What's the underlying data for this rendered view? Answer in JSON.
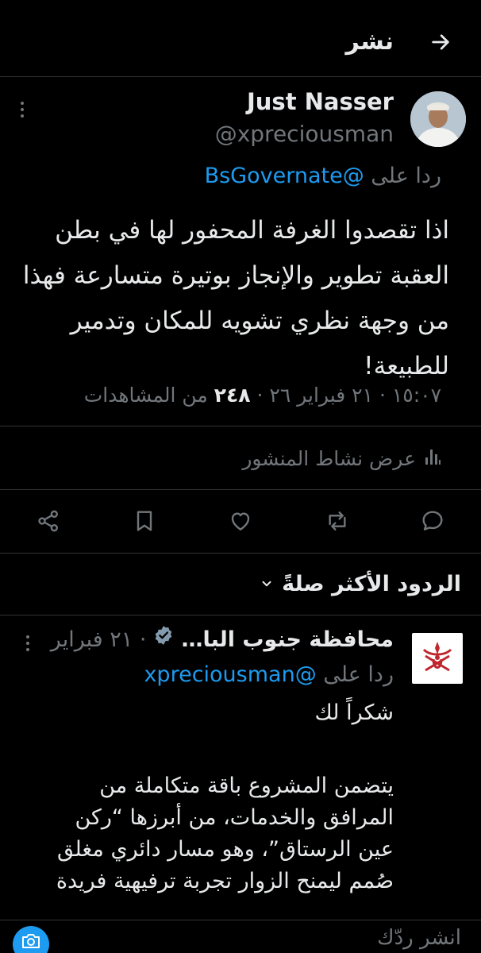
{
  "header": {
    "title": "نشر"
  },
  "tweet": {
    "author_name": "Just Nasser",
    "author_handle": "@xpreciousman",
    "reply_prefix": "ردا على",
    "reply_to": "@BsGovernate",
    "text": "اذا تقصدوا الغرفة المحفور لها في بطن\nالعقبة تطوير والإنجاز بوتيرة متسارعة فهذا\nمن وجهة نظري تشويه للمكان وتدمير\nللطبيعة!",
    "time": "١٥:٠٧",
    "sep": " · ",
    "date": "٢١ فبراير ٢٦",
    "views": "٢٤٨",
    "views_label": "من المشاهدات",
    "activity_label": "عرض نشاط المنشور"
  },
  "actions": [
    "reply-icon",
    "repost-icon",
    "like-icon",
    "bookmark-icon",
    "share-icon"
  ],
  "sort": {
    "label": "الردود الأكثر صلةً"
  },
  "reply": {
    "author_name": "محافظة جنوب البا…",
    "date": "٢١ فبراير",
    "sep": " · ",
    "reply_prefix": "ردا على",
    "reply_to": "@xpreciousman",
    "line1": "شكراً لك",
    "body": "يتضمن المشروع باقة متكاملة من\nالمرافق والخدمات، من أبرزها “ركن\nعين الرستاق”، وهو مسار دائري مغلق\nصُمم ليمنح الزوار تجربة ترفيهية فريدة"
  },
  "compose": {
    "placeholder": "انشر ردّك"
  },
  "colors": {
    "background": "#000000",
    "text": "#e7e9ea",
    "muted": "#71767b",
    "accent": "#1d9bf0",
    "divider": "#2f3336"
  }
}
